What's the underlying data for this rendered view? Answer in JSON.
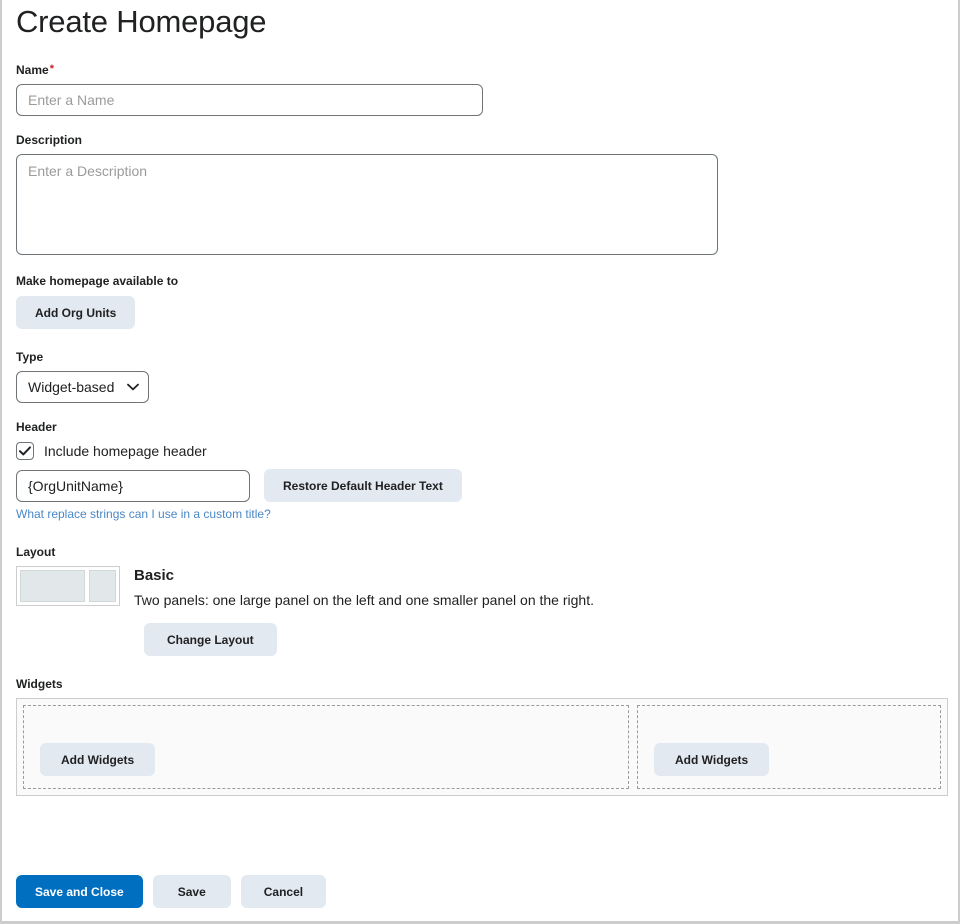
{
  "page": {
    "title": "Create Homepage"
  },
  "fields": {
    "name": {
      "label": "Name",
      "required_marker": "*",
      "value": "",
      "placeholder": "Enter a Name"
    },
    "description": {
      "label": "Description",
      "value": "",
      "placeholder": "Enter a Description"
    },
    "availability": {
      "label": "Make homepage available to",
      "add_org_units_button": "Add Org Units"
    },
    "type": {
      "label": "Type",
      "selected": "Widget-based",
      "options": [
        "Widget-based"
      ],
      "chevron_icon": "chevron-down-icon"
    },
    "header": {
      "label": "Header",
      "include_checkbox_label": "Include homepage header",
      "include_checked": true,
      "check_icon": "check-icon",
      "header_text_value": "{OrgUnitName}",
      "restore_button": "Restore Default Header Text",
      "help_link": "What replace strings can I use in a custom title?"
    },
    "layout": {
      "label": "Layout",
      "preview_icon": "layout-two-panel-icon",
      "name": "Basic",
      "description": "Two panels: one large panel on the left and one smaller panel on the right.",
      "change_button": "Change Layout"
    },
    "widgets": {
      "label": "Widgets",
      "panels": [
        {
          "position": "left",
          "add_button": "Add Widgets"
        },
        {
          "position": "right",
          "add_button": "Add Widgets"
        }
      ]
    }
  },
  "footer": {
    "save_and_close": "Save and Close",
    "save": "Save",
    "cancel": "Cancel"
  },
  "colors": {
    "primary": "#006FBF",
    "soft_button": "#E3E9F1",
    "link": "#4A87C7",
    "required": "#CD2026",
    "border": "#6E7477",
    "panel_border": "#CDCDCD"
  }
}
